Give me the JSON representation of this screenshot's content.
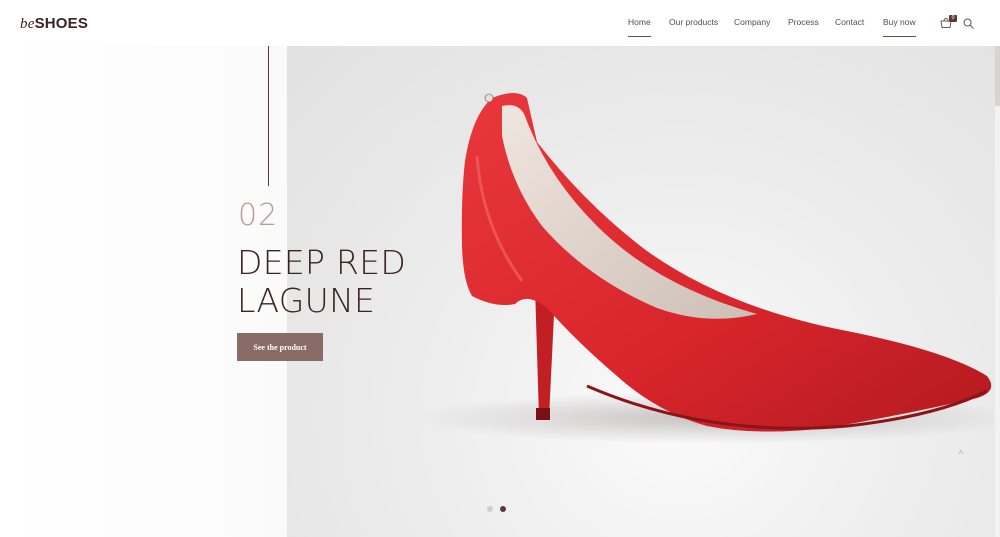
{
  "brand": {
    "be": "be",
    "shoes": "SHOES"
  },
  "nav": {
    "items": [
      {
        "label": "Home"
      },
      {
        "label": "Our products"
      },
      {
        "label": "Company"
      },
      {
        "label": "Process"
      },
      {
        "label": "Contact"
      },
      {
        "label": "Buy now"
      }
    ]
  },
  "cart": {
    "icon": "cart-icon",
    "count": "0"
  },
  "search": {
    "icon": "search-icon"
  },
  "hero": {
    "slide_number": "02",
    "title_line1": "DEEP RED",
    "title_line2": "LAGUNE",
    "cta_label": "See the product"
  },
  "slider": {
    "count": 2,
    "active_index": 1
  },
  "colors": {
    "brand": "#3b2323",
    "accent": "#8a6c66",
    "shoe": "#d9262c"
  }
}
